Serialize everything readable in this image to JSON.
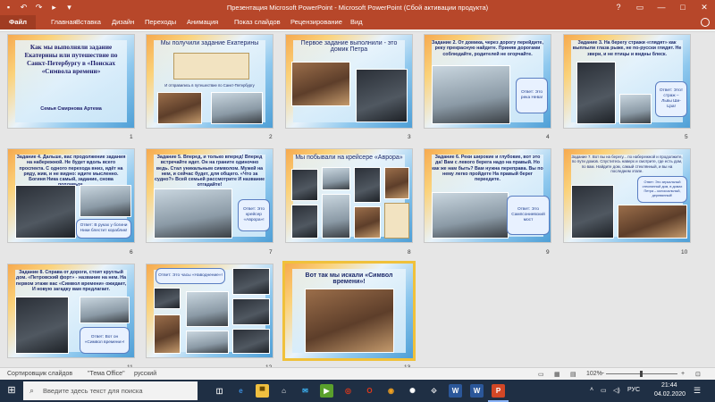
{
  "window": {
    "title": "Презентация Microsoft PowerPoint - Microsoft PowerPoint (Сбой активации продукта)",
    "qa_icons": [
      "save-icon",
      "undo-icon",
      "redo-icon",
      "start-from-beginning-icon",
      "customize-icon"
    ],
    "controls": [
      "?",
      "▭",
      "—",
      "□",
      "✕"
    ]
  },
  "ribbon": {
    "tabs": [
      "Файл",
      "Главная",
      "Вставка",
      "Дизайн",
      "Переходы",
      "Анимация",
      "Показ слайдов",
      "Рецензирование",
      "Вид"
    ]
  },
  "slides": [
    {
      "num": "1",
      "title": "Как мы выполняли задание Екатерины или путешествие по Санкт-Петербургу в «Поисках «Символа времени»",
      "author": "Семья Смирнова Артема"
    },
    {
      "num": "2",
      "title": "Мы получили задание Екатерины",
      "caption": "И отправились в путешествие по Санкт-Петербургу"
    },
    {
      "num": "3",
      "title": "Первое задание выполнили - это домик Петра"
    },
    {
      "num": "4",
      "title": "Задание 2. От домика, через дорогу перейдите, реку прекрасную найдите. Приняв дорогами соблюдайте, родителей не огорчайте.",
      "answer": "Ответ: Это река Нева!"
    },
    {
      "num": "5",
      "title": "Задание 3. На берегу стражи «глядят» как выплыли глаза рыже, не по-русски глядят. Не звери, и не птицы и видны блеск.",
      "answer": "Ответ: Этот страж – Львы Ши-Цза!"
    },
    {
      "num": "6",
      "title": "Задание 4. Дальше, вас продолжение задания на набережной. Не будет вдоль всего проспекта. С одного перехода вниз, идёт на ряду, жив, и не видно: идите мысленно. Богиня Ника самый, задание, снова поплавьте.",
      "answer": "Ответ: В руках у богини Ники блестит кораблик!"
    },
    {
      "num": "7",
      "title": "Задание 5. Вперед, и только вперед! Вперед встречайте идет. Он на граните одиночно ведь. Стал уникальным символом. Мужей на нем, и сейчас будет, для общего. «Что за судно?» Всей семьей рассмотрите И название отгадайте!",
      "answer": "Ответ: Это крейсер «Аврора»!"
    },
    {
      "num": "8",
      "title": "Мы побывали на крейсере «Аврора»"
    },
    {
      "num": "9",
      "title": "Задание 6. Реки широкие и глубокие, вот это да! Вам с левого берега надо на правый. Но как же нам быть? Вам нужна переправа. Вы по нему легко пройдете На правый берег переедите.",
      "answer": "Ответ: Это Сампсониевский мост"
    },
    {
      "num": "10",
      "title": "Задание 7. Вот вы на берегу... по набережной и продолжите, по пути домов. Спуститесь наверх и смотрите, где есть дом, по вам. Найдите дом, самый стеклянный, и вы на последнем этапе.",
      "answer": "Ответ: Это зеркальный стеклянный дом, в домах Петра – колоссальный, деревянный!"
    },
    {
      "num": "11",
      "title": "Задание 8. Справа от дороги, стоит круглый дом. «Петровский форт» - название на нем. На первом этаже вас «Символ времени» ожидает, И новую загадку вам предлагает.",
      "answer": "Ответ: Вот он «Символ времени»!"
    },
    {
      "num": "12",
      "answer": "Ответ: Это часы «Наводнение»!"
    },
    {
      "num": "13",
      "title": "Вот так мы искали «Символ времени»!"
    }
  ],
  "status": {
    "view": "Сортировщик слайдов",
    "theme": "\"Тема Office\"",
    "language": "русский",
    "zoom": "102%"
  },
  "taskbar": {
    "search_placeholder": "Введите здесь текст для поиска",
    "language": "РУС",
    "time": "21:44",
    "date": "04.02.2020"
  }
}
